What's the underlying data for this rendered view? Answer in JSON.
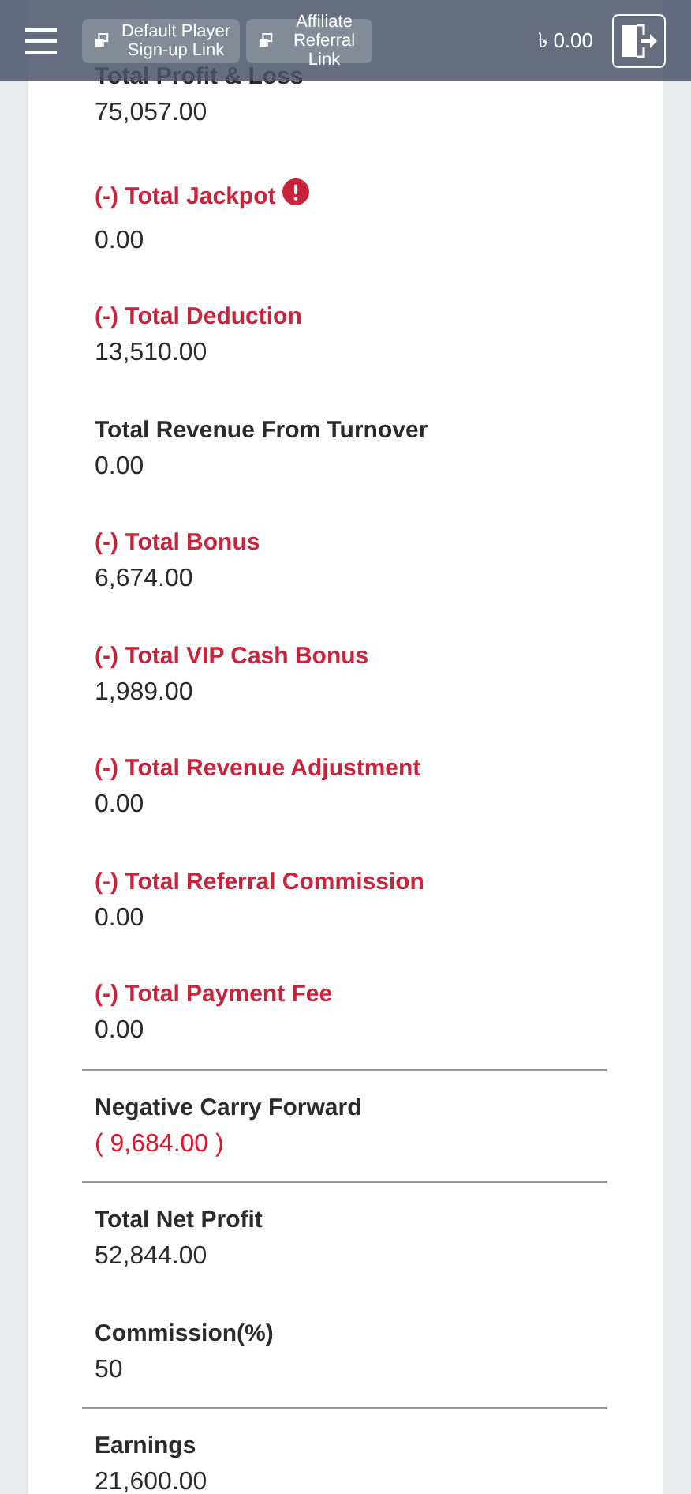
{
  "header": {
    "links": [
      {
        "label": "Default Player Sign-up Link"
      },
      {
        "label": "Affiliate Referral Link"
      }
    ],
    "balance": "৳ 0.00"
  },
  "rows": [
    {
      "kind": "normal",
      "label": "Total Profit & Loss",
      "value": "75,057.00",
      "negative": false,
      "info": false
    },
    {
      "kind": "deduction",
      "label": "(-) Total Jackpot",
      "value": "0.00",
      "negative": false,
      "info": true
    },
    {
      "kind": "deduction",
      "label": "(-) Total Deduction",
      "value": "13,510.00",
      "negative": false,
      "info": false
    },
    {
      "kind": "normal",
      "label": "Total Revenue From Turnover",
      "value": "0.00",
      "negative": false,
      "info": false
    },
    {
      "kind": "deduction",
      "label": "(-) Total Bonus",
      "value": "6,674.00",
      "negative": false,
      "info": false
    },
    {
      "kind": "deduction",
      "label": "(-) Total VIP Cash Bonus",
      "value": "1,989.00",
      "negative": false,
      "info": false
    },
    {
      "kind": "deduction",
      "label": "(-) Total Revenue Adjustment",
      "value": "0.00",
      "negative": false,
      "info": false
    },
    {
      "kind": "deduction",
      "label": "(-) Total Referral Commission",
      "value": "0.00",
      "negative": false,
      "info": false
    },
    {
      "kind": "deduction",
      "label": "(-) Total Payment Fee",
      "value": "0.00",
      "negative": false,
      "info": false
    },
    {
      "kind": "divider"
    },
    {
      "kind": "normal",
      "label": "Negative Carry Forward",
      "value": "( 9,684.00 )",
      "negative": true,
      "info": false
    },
    {
      "kind": "divider"
    },
    {
      "kind": "normal",
      "label": "Total Net Profit",
      "value": "52,844.00",
      "negative": false,
      "info": false
    },
    {
      "kind": "normal",
      "label": "Commission(%)",
      "value": "50",
      "negative": false,
      "info": false
    },
    {
      "kind": "divider"
    },
    {
      "kind": "normal",
      "label": "Earnings",
      "value": "21,600.00",
      "negative": false,
      "info": false
    }
  ]
}
